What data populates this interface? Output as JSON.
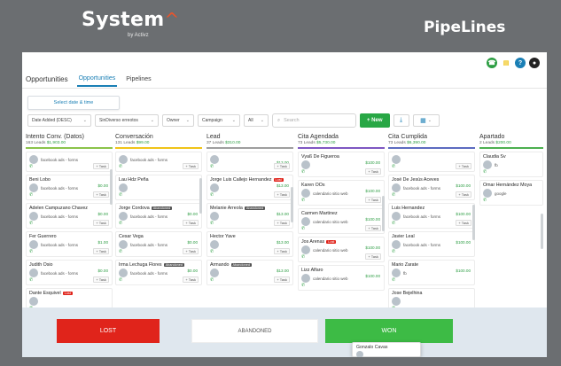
{
  "header": {
    "brand": "System",
    "brand_accent": "^",
    "brand_sub": "by Activz",
    "right_title": "PipeLines"
  },
  "top_icons": [
    "phone-icon",
    "chat-icon",
    "help-icon",
    "user-icon"
  ],
  "topnav": {
    "title": "Opportunities",
    "tab_active": "Opportunities",
    "tab_other": "Pipelines"
  },
  "date_button": "Select date & time",
  "filters": {
    "sort": "Date Added (DESC)",
    "pipeline": "SinDiverso erreotos",
    "owner": "Owner",
    "campaign": "Campaign",
    "all": "All",
    "search_placeholder": "Search",
    "new_label": "+ New"
  },
  "columns": [
    {
      "title": "Intento Conv. (Datos)",
      "leads": "163 Leads",
      "amount": "$1,903.00",
      "color": "#8bc34a",
      "cards": [
        {
          "name": "",
          "source": "facebook ads - forms",
          "task": "+ Task"
        },
        {
          "name": "Beni Lobo",
          "source": "facebook ads - forms",
          "amount": "$0.00",
          "task": "+ Task"
        },
        {
          "name": "Adelen Campuzano Chavez",
          "source": "facebook ads - forms",
          "amount": "$0.00",
          "task": "+ Task"
        },
        {
          "name": "Fer Guerrero",
          "source": "facebook ads - forms",
          "amount": "$1.00",
          "task": "+ Task"
        },
        {
          "name": "Judith Osio",
          "source": "facebook ads - forms",
          "amount": "$0.00",
          "task": "+ Task"
        },
        {
          "name": "Dante Esquivel",
          "tag": "Lost",
          "source": "",
          "task": ""
        }
      ]
    },
    {
      "title": "Conversación",
      "leads": "131 Leads",
      "amount": "$99.00",
      "color": "#f0c419",
      "cards": [
        {
          "name": "",
          "source": "facebook ads - forms",
          "task": "+ Task"
        },
        {
          "name": "Lau Hdz Peña",
          "source": "",
          "task": ""
        },
        {
          "name": "Jorge Cordova",
          "tag": "Abandoned",
          "source": "facebook ads - forms",
          "amount": "$0.00",
          "task": "+ Task"
        },
        {
          "name": "Cesar Vega",
          "source": "facebook ads - forms",
          "amount": "$0.00",
          "task": "+ Task"
        },
        {
          "name": "Irma Lechuga Flores",
          "tag": "Abandoned",
          "source": "facebook ads - forms",
          "amount": "$0.00",
          "task": "+ Task"
        }
      ]
    },
    {
      "title": "Lead",
      "leads": "37 Leads",
      "amount": "$310.00",
      "color": "#9e9e9e",
      "cards": [
        {
          "name": "",
          "source": "",
          "amount": "$13.00",
          "task": "+ Task"
        },
        {
          "name": "Jorge Luis Callejo Hernandez",
          "tag": "Lost",
          "source": "",
          "amount": "$13.00",
          "task": "+ Task"
        },
        {
          "name": "Melanie Arreola",
          "tag": "Abandoned",
          "source": "",
          "amount": "$13.00",
          "task": "+ Task"
        },
        {
          "name": "Hector Yave",
          "source": "",
          "amount": "$13.00",
          "task": "+ Task"
        },
        {
          "name": "Armando",
          "tag": "Abandoned",
          "source": "",
          "amount": "$13.00",
          "task": "+ Task"
        }
      ]
    },
    {
      "title": "Cita Agendada",
      "leads": "73 Leads",
      "amount": "$5,730.00",
      "color": "#7e57c2",
      "cards": [
        {
          "name": "Vyaß De Figueroa",
          "source": "",
          "amount": "$100.00",
          "task": "+ Task"
        },
        {
          "name": "Karen OOs",
          "source": "calendario sitio web",
          "amount": "$100.00",
          "task": "+ Task"
        },
        {
          "name": "Carmen Martinez",
          "source": "calendario sitio web",
          "amount": "$100.00",
          "task": "+ Task"
        },
        {
          "name": "Jos Arenas",
          "tag": "Lost",
          "source": "calendario sitio web",
          "amount": "$100.00",
          "task": "+ Task"
        },
        {
          "name": "Lizz Alfaro",
          "source": "calendario sitio web",
          "amount": "$100.00",
          "task": ""
        }
      ]
    },
    {
      "title": "Cita Cumplida",
      "leads": "73 Leads",
      "amount": "$6,390.00",
      "color": "#5c6bc0",
      "cards": [
        {
          "name": "",
          "source": "",
          "task": "+ Task"
        },
        {
          "name": "José De Jesús Aceves",
          "source": "facebook ads - forms",
          "amount": "$100.00",
          "task": "+ Task"
        },
        {
          "name": "Luis Hernandez",
          "source": "facebook ads - forms",
          "amount": "$100.00",
          "task": "+ Task"
        },
        {
          "name": "Javier Leal",
          "source": "facebook ads - forms",
          "amount": "$100.00",
          "task": ""
        },
        {
          "name": "Mario Zarate",
          "source": "fb",
          "amount": "$100.00",
          "task": ""
        },
        {
          "name": "Jose Bejelhina",
          "source": "",
          "task": ""
        }
      ]
    },
    {
      "title": "Apartado",
      "leads": "2 Leads",
      "amount": "$200.00",
      "color": "#4caf50",
      "cards": [
        {
          "name": "Claudia Sv",
          "source": "fb",
          "amount": "",
          "task": ""
        },
        {
          "name": "Omar Hernández Moya",
          "source": "google",
          "amount": "",
          "task": ""
        }
      ]
    }
  ],
  "bottom": {
    "lost": "LOST",
    "abandoned": "ABANDONED",
    "won": "WON",
    "peek_name": "Gonzalo Cavas"
  }
}
